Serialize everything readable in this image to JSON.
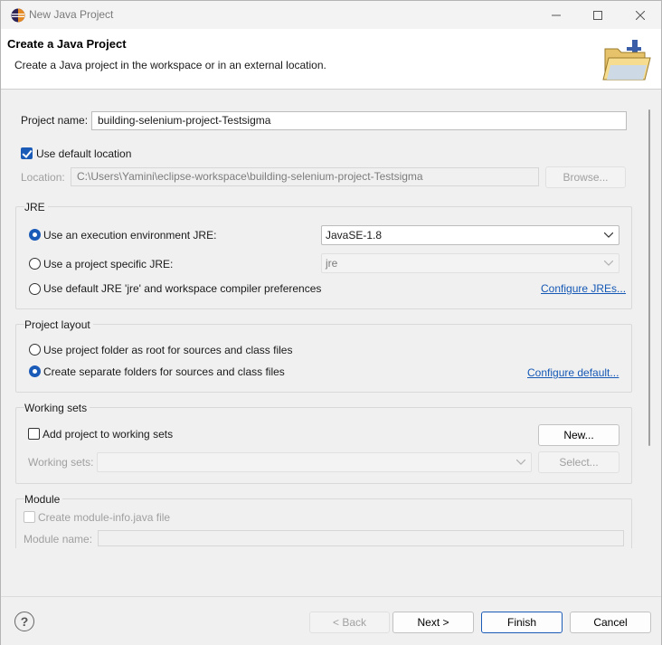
{
  "window": {
    "title": "New Java Project",
    "minimize_icon": "minimize-icon",
    "maximize_icon": "maximize-icon",
    "close_icon": "close-icon"
  },
  "banner": {
    "title": "Create a Java Project",
    "description": "Create a Java project in the workspace or in an external location.",
    "image_icon": "java-project-folder-icon"
  },
  "project": {
    "name_label": "Project name:",
    "name_value": "building-selenium-project-Testsigma",
    "default_location_label": "Use default location",
    "default_location_checked": true,
    "location_label": "Location:",
    "location_value": "C:\\Users\\Yamini\\eclipse-workspace\\building-selenium-project-Testsigma",
    "browse_label": "Browse..."
  },
  "jre": {
    "group_title": "JRE",
    "option_env_label": "Use an execution environment JRE:",
    "option_env_value": "JavaSE-1.8",
    "option_specific_label": "Use a project specific JRE:",
    "option_specific_value": "jre",
    "option_default_label": "Use default JRE 'jre' and workspace compiler preferences",
    "configure_link": "Configure JREs...",
    "selected": "env"
  },
  "layout": {
    "group_title": "Project layout",
    "option_root_label": "Use project folder as root for sources and class files",
    "option_separate_label": "Create separate folders for sources and class files",
    "configure_link": "Configure default...",
    "selected": "separate"
  },
  "working_sets": {
    "group_title": "Working sets",
    "add_label": "Add project to working sets",
    "add_checked": false,
    "new_label": "New...",
    "sets_label": "Working sets:",
    "sets_value": "",
    "select_label": "Select..."
  },
  "module": {
    "group_title": "Module",
    "create_label": "Create module-info.java file",
    "create_checked": false,
    "name_label": "Module name:",
    "name_value": ""
  },
  "footer": {
    "help_icon": "help-icon",
    "help_glyph": "?",
    "back_label": "< Back",
    "next_label": "Next >",
    "finish_label": "Finish",
    "cancel_label": "Cancel"
  },
  "colors": {
    "accent": "#1b5bb8",
    "link": "#1558b5",
    "disabled_text": "#a0a0a0"
  }
}
